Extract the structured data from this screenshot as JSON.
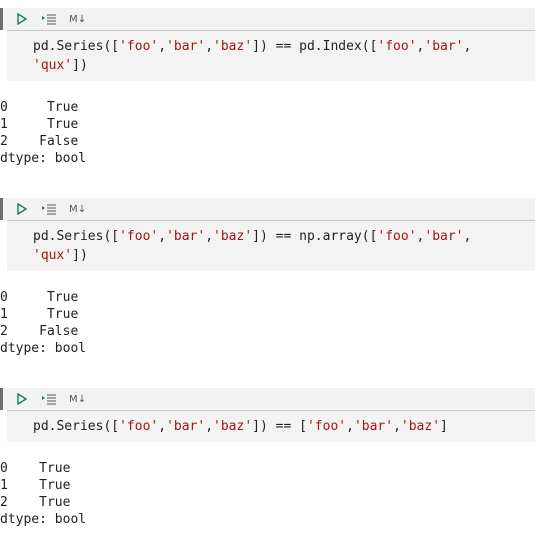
{
  "toolbar": {
    "run_icon": "play-icon",
    "exec_above_icon": "execute-above-icon",
    "markdown_label": "M↓"
  },
  "cells": [
    {
      "code_lines": [
        [
          {
            "t": "pd.Series([",
            "k": "plain"
          },
          {
            "t": "'foo'",
            "k": "str"
          },
          {
            "t": ",",
            "k": "plain"
          },
          {
            "t": "'bar'",
            "k": "str"
          },
          {
            "t": ",",
            "k": "plain"
          },
          {
            "t": "'baz'",
            "k": "str"
          },
          {
            "t": "]) == pd.Index([",
            "k": "plain"
          },
          {
            "t": "'foo'",
            "k": "str"
          },
          {
            "t": ",",
            "k": "plain"
          },
          {
            "t": "'bar'",
            "k": "str"
          },
          {
            "t": ",",
            "k": "plain"
          }
        ],
        [
          {
            "t": "'qux'",
            "k": "str"
          },
          {
            "t": "])",
            "k": "plain"
          }
        ]
      ],
      "output": "0     True\n1     True\n2    False\ndtype: bool"
    },
    {
      "code_lines": [
        [
          {
            "t": "pd.Series([",
            "k": "plain"
          },
          {
            "t": "'foo'",
            "k": "str"
          },
          {
            "t": ",",
            "k": "plain"
          },
          {
            "t": "'bar'",
            "k": "str"
          },
          {
            "t": ",",
            "k": "plain"
          },
          {
            "t": "'baz'",
            "k": "str"
          },
          {
            "t": "]) == np.array([",
            "k": "plain"
          },
          {
            "t": "'foo'",
            "k": "str"
          },
          {
            "t": ",",
            "k": "plain"
          },
          {
            "t": "'bar'",
            "k": "str"
          },
          {
            "t": ",",
            "k": "plain"
          }
        ],
        [
          {
            "t": "'qux'",
            "k": "str"
          },
          {
            "t": "])",
            "k": "plain"
          }
        ]
      ],
      "output": "0     True\n1     True\n2    False\ndtype: bool"
    },
    {
      "code_lines": [
        [
          {
            "t": "pd.Series([",
            "k": "plain"
          },
          {
            "t": "'foo'",
            "k": "str"
          },
          {
            "t": ",",
            "k": "plain"
          },
          {
            "t": "'bar'",
            "k": "str"
          },
          {
            "t": ",",
            "k": "plain"
          },
          {
            "t": "'baz'",
            "k": "str"
          },
          {
            "t": "]) == [",
            "k": "plain"
          },
          {
            "t": "'foo'",
            "k": "str"
          },
          {
            "t": ",",
            "k": "plain"
          },
          {
            "t": "'bar'",
            "k": "str"
          },
          {
            "t": ",",
            "k": "plain"
          },
          {
            "t": "'baz'",
            "k": "str"
          },
          {
            "t": "]",
            "k": "plain"
          }
        ]
      ],
      "output": "0    True\n1    True\n2    True\ndtype: bool"
    }
  ],
  "colors": {
    "string": "#a31515",
    "cell_background": "#f3f3f3",
    "toolbar_background": "#f2f2f2",
    "run_icon": "#16825d"
  }
}
